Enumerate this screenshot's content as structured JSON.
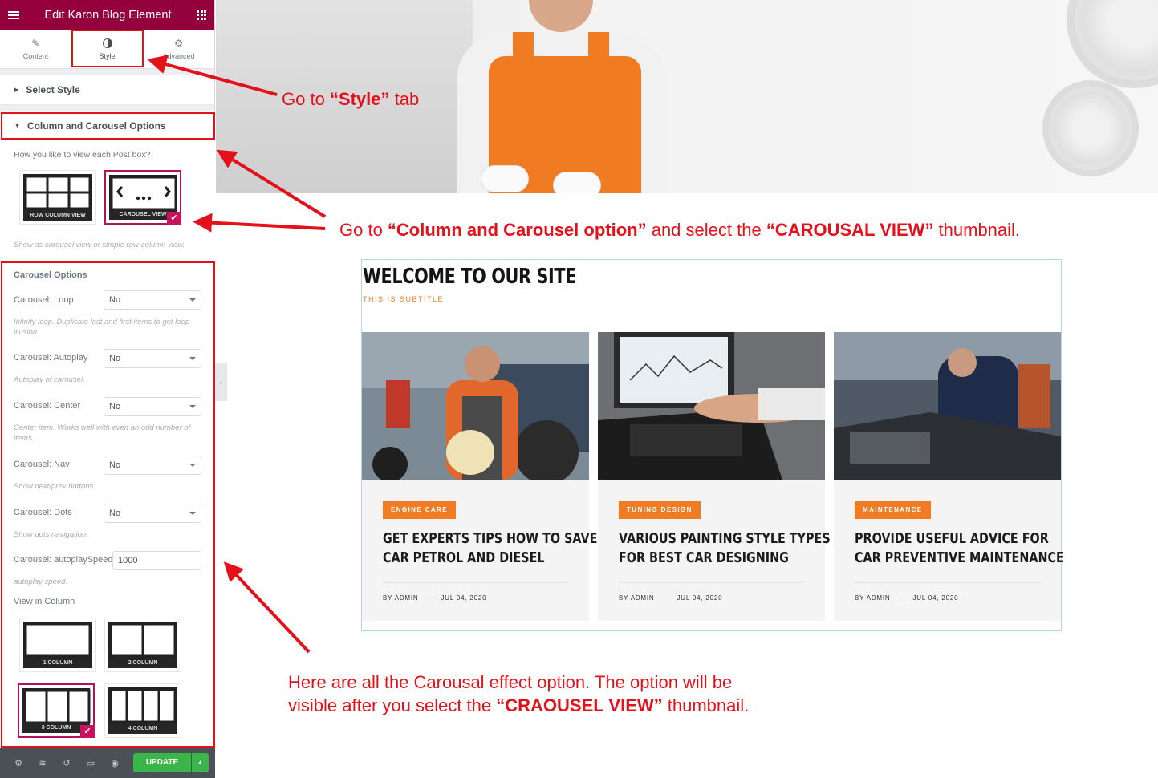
{
  "panel": {
    "title": "Edit Karon Blog Element",
    "tabs": [
      {
        "label": "Content",
        "icon": "pencil-icon"
      },
      {
        "label": "Style",
        "icon": "contrast-icon"
      },
      {
        "label": "Advanced",
        "icon": "gear-icon"
      }
    ],
    "select_style": "Select Style",
    "column_section": "Column and Carousel Options",
    "view_question": "How you like to view each Post box?",
    "view_options": [
      {
        "label": "ROW COLUMN VIEW",
        "selected": false
      },
      {
        "label": "CAROUSEL VIEW",
        "selected": true
      }
    ],
    "view_help": "Show as carousel view or simple row-column view.",
    "carousel_heading": "Carousel Options",
    "fields": [
      {
        "label": "Carousel: Loop",
        "value": "No",
        "help": "Infinity loop. Duplicate last and first items to get loop illusion."
      },
      {
        "label": "Carousel: Autoplay",
        "value": "No",
        "help": "Autoplay of carousel."
      },
      {
        "label": "Carousel: Center",
        "value": "No",
        "help": "Center item. Works well with even an odd number of items."
      },
      {
        "label": "Carousel: Nav",
        "value": "No",
        "help": "Show next/prev buttons."
      },
      {
        "label": "Carousel: Dots",
        "value": "No",
        "help": "Show dots navigation."
      }
    ],
    "speed": {
      "label": "Carousel: autoplaySpeed",
      "value": "1000",
      "help": "autoplay speed."
    },
    "column_heading": "View in Column",
    "columns": [
      {
        "label": "1 COLUMN",
        "count": 1,
        "selected": false
      },
      {
        "label": "2 COLUMN",
        "count": 2,
        "selected": false
      },
      {
        "label": "3 COLUMN",
        "count": 3,
        "selected": true
      },
      {
        "label": "4 COLUMN",
        "count": 4,
        "selected": false
      }
    ],
    "footer": {
      "update_label": "UPDATE"
    }
  },
  "annotations": {
    "style_tab_pre": "Go  to ",
    "style_tab_bold": "“Style”",
    "style_tab_post": " tab",
    "carousel_pre": "Go to ",
    "carousel_bold1": "“Column and Carousel option”",
    "carousel_mid": " and select the ",
    "carousel_bold2": "“CAROUSAL VIEW”",
    "carousel_post": " thumbnail.",
    "options_line1": "Here are all the Carousal effect option. The option will be",
    "options_line2_pre": "visible after you select the ",
    "options_line2_bold": "“CRAOUSEL VIEW”",
    "options_line2_post": " thumbnail."
  },
  "preview": {
    "title": "WELCOME TO OUR SITE",
    "subtitle": "THIS IS SUBTITLE",
    "posts": [
      {
        "tag": "ENGINE CARE",
        "title_1": "GET EXPERTS TIPS HOW TO SAVE",
        "title_2": "CAR PETROL AND DIESEL",
        "author": "BY ADMIN",
        "date": "JUL 04, 2020"
      },
      {
        "tag": "TUNING DESIGN",
        "title_1": "VARIOUS PAINTING STYLE TYPES",
        "title_2": "FOR BEST CAR DESIGNING",
        "author": "BY ADMIN",
        "date": "JUL 04, 2020"
      },
      {
        "tag": "MAINTENANCE",
        "title_1": "PROVIDE USEFUL ADVICE FOR",
        "title_2": "CAR PREVENTIVE MAINTENANCE",
        "author": "BY ADMIN",
        "date": "JUL 04, 2020"
      }
    ]
  },
  "colors": {
    "brand": "#93003c",
    "accent": "#f07b22",
    "annotation": "#e4101a",
    "update": "#39b54a"
  }
}
